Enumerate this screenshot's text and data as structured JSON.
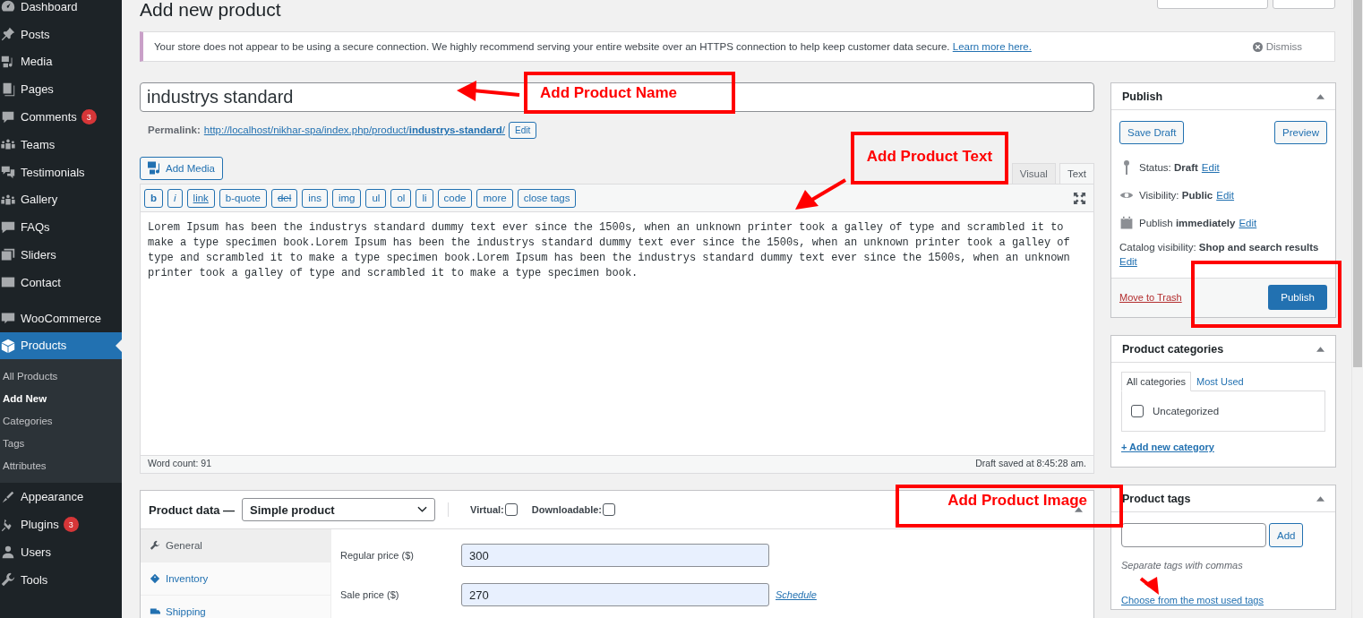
{
  "sidebar": {
    "groups": [
      [
        {
          "label": "Dashboard",
          "selected": false
        },
        {
          "label": "Posts",
          "selected": false
        },
        {
          "label": "Media",
          "selected": false
        },
        {
          "label": "Pages",
          "selected": false
        },
        {
          "label": "Comments",
          "badge": "3",
          "selected": false
        },
        {
          "label": "Teams",
          "selected": false
        },
        {
          "label": "Testimonials",
          "selected": false
        },
        {
          "label": "Gallery",
          "selected": false
        },
        {
          "label": "FAQs",
          "selected": false
        },
        {
          "label": "Sliders",
          "selected": false
        },
        {
          "label": "Contact",
          "selected": false
        }
      ],
      [
        {
          "label": "WooCommerce",
          "selected": false
        },
        {
          "label": "Products",
          "selected": true,
          "children": [
            {
              "label": "All Products",
              "selected": false
            },
            {
              "label": "Add New",
              "selected": true
            },
            {
              "label": "Categories",
              "selected": false
            },
            {
              "label": "Tags",
              "selected": false
            },
            {
              "label": "Attributes",
              "selected": false
            }
          ]
        }
      ],
      [
        {
          "label": "Appearance",
          "selected": false
        },
        {
          "label": "Plugins",
          "badge": "3",
          "selected": false
        },
        {
          "label": "Users",
          "selected": false
        },
        {
          "label": "Tools",
          "selected": false
        }
      ]
    ]
  },
  "page_title": "Add new product",
  "notice": {
    "text": "Your store does not appear to be using a secure connection. We highly recommend serving your entire website over an HTTPS connection to help keep customer data secure.",
    "link": "Learn more here.",
    "dismiss": "Dismiss"
  },
  "title_field": {
    "value": "industrys standard"
  },
  "permalink": {
    "label": "Permalink:",
    "url": "http://localhost/nikhar-spa/index.php/product/**industrys-standard**/",
    "edit": "Edit"
  },
  "add_media": "Add Media",
  "editor_tabs": [
    {
      "label": "Visual",
      "selected": false
    },
    {
      "label": "Text",
      "selected": true
    }
  ],
  "quicktags": [
    {
      "label": "b",
      "kind": "bold"
    },
    {
      "label": "i",
      "kind": "italic"
    },
    {
      "label": "link",
      "kind": "underline"
    },
    {
      "label": "b-quote",
      "kind": "plain"
    },
    {
      "label": "del",
      "kind": "strike"
    },
    {
      "label": "ins",
      "kind": "plain"
    },
    {
      "label": "img",
      "kind": "plain"
    },
    {
      "label": "ul",
      "kind": "plain"
    },
    {
      "label": "ol",
      "kind": "plain"
    },
    {
      "label": "li",
      "kind": "plain"
    },
    {
      "label": "code",
      "kind": "plain"
    },
    {
      "label": "more",
      "kind": "plain"
    },
    {
      "label": "close tags",
      "kind": "plain"
    }
  ],
  "editor_text": "Lorem Ipsum has been the industrys standard dummy text ever since the 1500s, when an unknown printer took a galley of type and scrambled it to make a type specimen book.Lorem Ipsum has been the industrys standard dummy text ever since the 1500s, when an unknown printer took a galley of type and scrambled it to make a type specimen book.Lorem Ipsum has been the industrys standard dummy text ever since the 1500s, when an unknown printer took a galley of type and scrambled it to make a type specimen book.",
  "word_count": "Word count: 91",
  "draft_saved": "Draft saved at 8:45:28 am.",
  "product_data": {
    "title": "Product data —",
    "type": "Simple product",
    "options": [
      {
        "label": "Virtual:",
        "checked": false
      },
      {
        "label": "Downloadable:",
        "checked": false
      }
    ],
    "tabs": [
      {
        "label": "General",
        "selected": true
      },
      {
        "label": "Inventory",
        "selected": false
      },
      {
        "label": "Shipping",
        "selected": false
      }
    ],
    "fields": [
      {
        "label": "Regular price ($)",
        "value": "300"
      },
      {
        "label": "Sale price ($)",
        "value": "270",
        "link": "Schedule"
      }
    ]
  },
  "publish": {
    "title": "Publish",
    "save_draft": "Save Draft",
    "preview": "Preview",
    "rows": [
      {
        "text": "Status: **Draft**",
        "edit": "Edit"
      },
      {
        "text": "Visibility: **Public**",
        "edit": "Edit"
      },
      {
        "text": "Publish **immediately**",
        "edit": "Edit"
      }
    ],
    "catalog": {
      "text": "Catalog visibility: **Shop and search results**",
      "edit": "Edit"
    },
    "trash": "Move to Trash",
    "publish": "Publish"
  },
  "categories": {
    "title": "Product categories",
    "tabs": [
      {
        "label": "All categories",
        "selected": true
      },
      {
        "label": "Most Used",
        "selected": false
      }
    ],
    "items": [
      {
        "label": "Uncategorized",
        "checked": false
      }
    ],
    "add_link": "+ Add new category"
  },
  "tags": {
    "title": "Product tags",
    "add": "Add",
    "hint": "Separate tags with commas",
    "link": "Choose from the most used tags"
  },
  "annotations": [
    {
      "kind": "name",
      "text": "Add Product Name"
    },
    {
      "kind": "text",
      "text": "Add Product Text"
    },
    {
      "kind": "publish"
    },
    {
      "kind": "image",
      "text": "Add Product Image"
    },
    {
      "kind": "tags"
    }
  ]
}
